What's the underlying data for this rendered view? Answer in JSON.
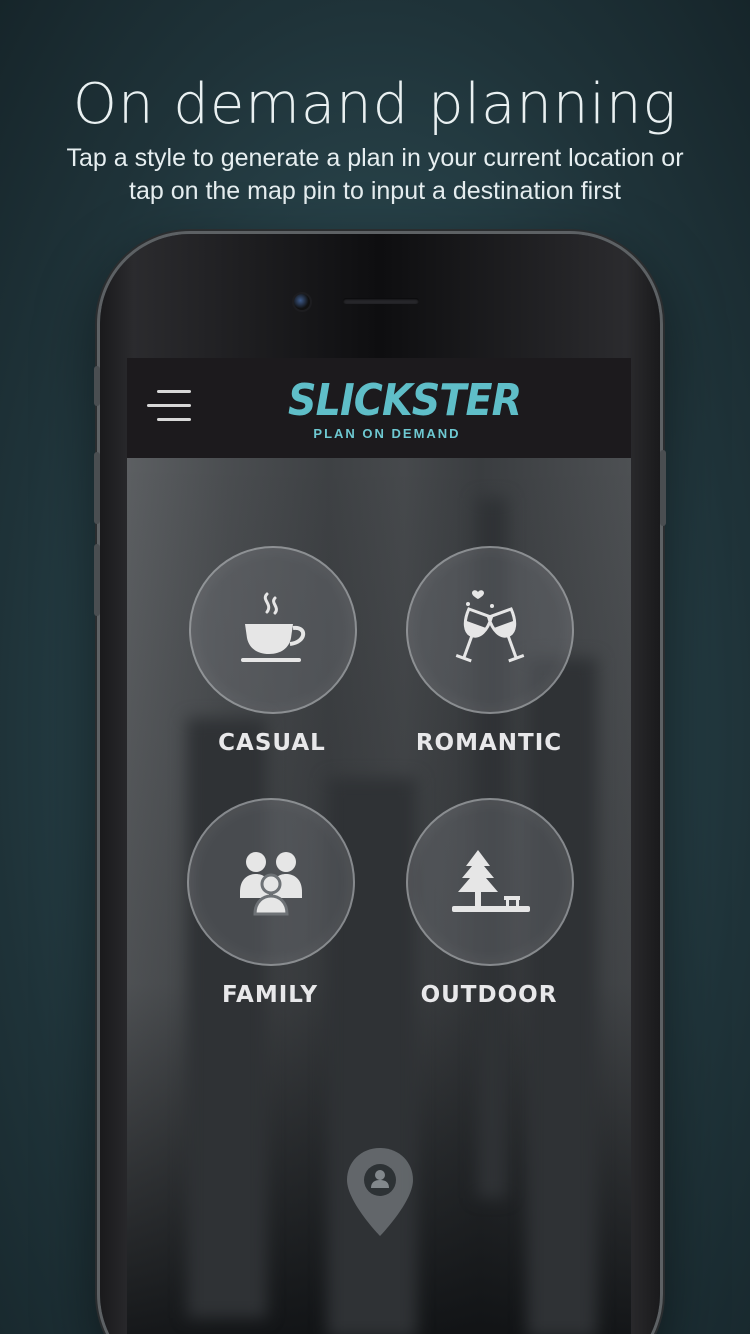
{
  "promo": {
    "headline": "On  demand planning",
    "subline": "Tap a style to generate a plan in your current location or tap on the map pin to input a destination first"
  },
  "app": {
    "logo_title": "SLICKSTER",
    "logo_tagline": "PLAN ON DEMAND",
    "accent_color": "#5fbec8"
  },
  "styles": [
    {
      "label": "CASUAL",
      "icon": "coffee-cup-icon"
    },
    {
      "label": "ROMANTIC",
      "icon": "wine-toast-icon"
    },
    {
      "label": "FAMILY",
      "icon": "family-icon"
    },
    {
      "label": "OUTDOOR",
      "icon": "tree-bench-icon"
    }
  ],
  "pin": {
    "icon": "location-pin-icon"
  }
}
